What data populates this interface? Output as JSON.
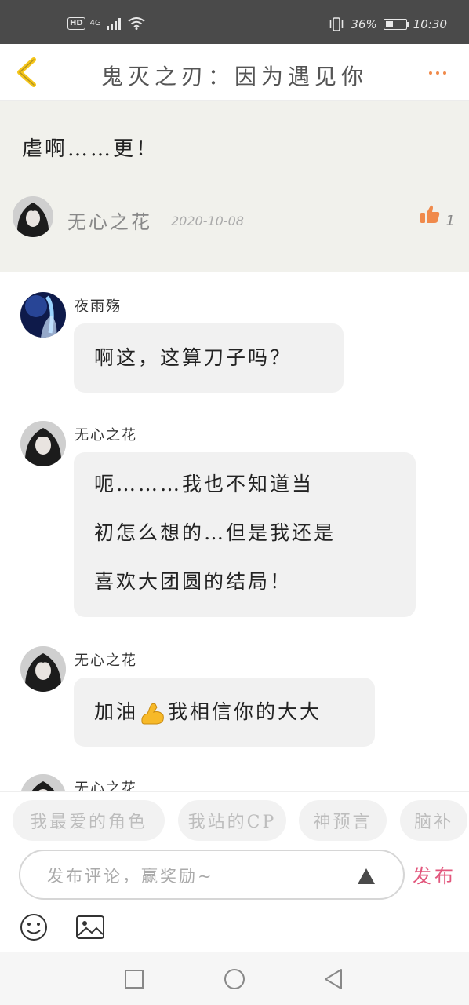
{
  "status_bar": {
    "hd": "HD",
    "network": "4G",
    "battery_percent": "36%",
    "battery_level": 0.36,
    "time": "10:30"
  },
  "header": {
    "title": "鬼灭之刃：因为遇见你",
    "back_icon": "chevron-left-icon",
    "more_icon": "more-dots-icon",
    "accent_color": "#f5c518"
  },
  "post": {
    "text": "虐啊……更！",
    "author": "无心之花",
    "date": "2020-10-08",
    "like_count": "1",
    "like_color": "#f08a4b"
  },
  "comments": [
    {
      "author": "夜雨殇",
      "lines": [
        "啊这，这算刀子吗？"
      ]
    },
    {
      "author": "无心之花",
      "lines": [
        "呃………我也不知道当",
        "初怎么想的…但是我还是",
        "喜欢大团圆的结局！"
      ]
    },
    {
      "author": "无心之花",
      "before_emoji": "加油",
      "emoji": "flexed-biceps-icon",
      "after_emoji": "我相信你的大大"
    },
    {
      "author": "无心之花"
    }
  ],
  "tags": [
    "我最爱的角色",
    "我站的CP",
    "神预言",
    "脑补"
  ],
  "input": {
    "placeholder": "发布评论，赢奖励~",
    "publish_label": "发布",
    "publish_color": "#e2577d"
  },
  "toolbar": {
    "emoji_icon": "smiley-icon",
    "image_icon": "image-icon"
  },
  "nav": [
    "recent-apps-icon",
    "home-icon",
    "back-icon"
  ]
}
